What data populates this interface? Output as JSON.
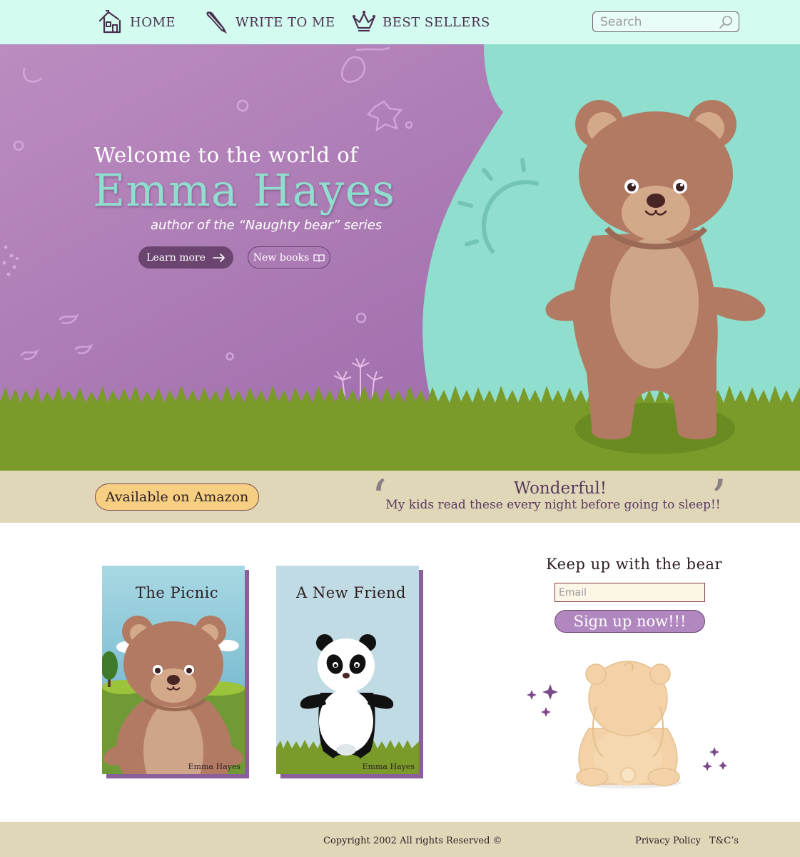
{
  "nav": {
    "items": [
      {
        "label": "HOME",
        "icon": "house-icon"
      },
      {
        "label": "WRITE TO ME",
        "icon": "quill-icon"
      },
      {
        "label": "BEST SELLERS",
        "icon": "crown-icon"
      }
    ],
    "search_placeholder": "Search"
  },
  "hero": {
    "welcome": "Welcome to the world of",
    "author_name": "Emma Hayes",
    "subtitle": "author of the “Naughty bear” series",
    "learn_more_label": "Learn more",
    "new_books_label": "New books"
  },
  "strip": {
    "amazon_label": "Available on Amazon",
    "testimonial_title": "Wonderful!",
    "testimonial_text": "My kids read these every night before going to sleep!!"
  },
  "books": [
    {
      "title": "The Picnic",
      "author": "Emma Hayes"
    },
    {
      "title": "A New Friend",
      "author": "Emma Hayes"
    }
  ],
  "signup": {
    "title": "Keep up with the bear",
    "email_placeholder": "Email",
    "button_label": "Sign up now!!!"
  },
  "footer": {
    "copyright": "Copyright 2002 All rights Reserved ©",
    "privacy": "Privacy Policy",
    "terms": "T&C’s"
  },
  "colors": {
    "nav_bg": "#d3fbf0",
    "hero_purple": "#ab7fb4",
    "hero_teal": "#8fdece",
    "grass": "#7a9a2a",
    "strip_bg": "#e0d7b9",
    "accent_dark": "#6b4470",
    "amazon_button": "#f6cf83"
  }
}
